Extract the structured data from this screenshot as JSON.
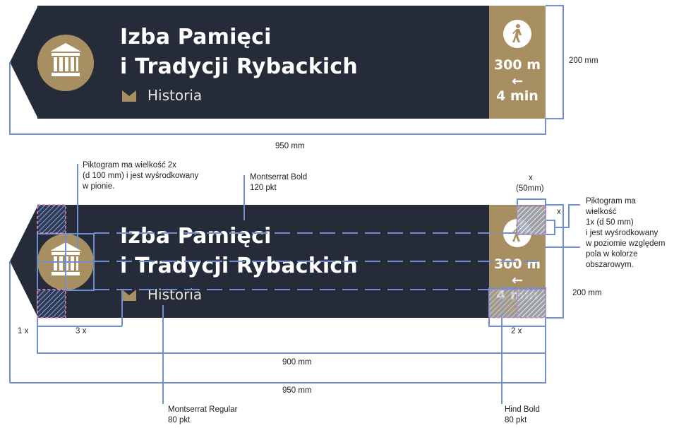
{
  "sign": {
    "title_line1": "Izba Pamięci",
    "title_line2": "i Tradycji Rybackich",
    "category": "Historia",
    "distance": "300 m",
    "arrow": "←",
    "time": "4 min"
  },
  "dimensions": {
    "height": "200 mm",
    "width_total": "950 mm",
    "width_body": "900 mm",
    "margin_left": "1 x",
    "margin_text": "3 x",
    "margin_right": "2 x",
    "x_label": "x",
    "x_value": "(50mm)",
    "x_small": "x"
  },
  "notes": {
    "pictogram_left": [
      "Piktogram ma wielkość 2x",
      "(d 100 mm) i jest wyśrodkowany",
      "w pionie."
    ],
    "font_title": [
      "Montserrat Bold",
      "120 pkt"
    ],
    "pictogram_right": [
      "Piktogram ma",
      "wielkość",
      "1x (d 50 mm)",
      "i jest wyśrodkowany",
      "w poziomie względem",
      "pola w kolorze",
      "obszarowym."
    ],
    "font_category": [
      "Montserrat Regular",
      "80 pkt"
    ],
    "font_distance": [
      "Hind Bold",
      "80 pkt"
    ]
  },
  "colors": {
    "navy": "#262b3a",
    "gold": "#a88f62",
    "dimension_line": "#6f8fcf",
    "guide_pink": "#e58ab8"
  }
}
